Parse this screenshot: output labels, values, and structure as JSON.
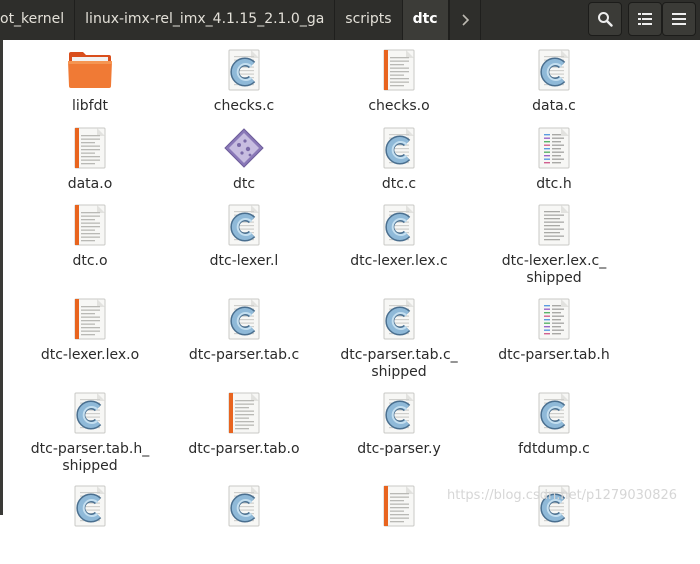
{
  "header": {
    "breadcrumbs": [
      "ot_kernel",
      "linux-imx-rel_imx_4.1.15_2.1.0_ga",
      "scripts",
      "dtc"
    ],
    "forward_icon": "chevron-right-icon",
    "search_icon": "search-icon",
    "view_icon": "list-view-icon",
    "menu_icon": "menu-icon"
  },
  "files": [
    {
      "name": "libfdt",
      "type": "folder"
    },
    {
      "name": "checks.c",
      "type": "c-source"
    },
    {
      "name": "checks.o",
      "type": "object"
    },
    {
      "name": "data.c",
      "type": "c-source"
    },
    {
      "name": "data.o",
      "type": "object"
    },
    {
      "name": "dtc",
      "type": "executable"
    },
    {
      "name": "dtc.c",
      "type": "c-source"
    },
    {
      "name": "dtc.h",
      "type": "header"
    },
    {
      "name": "dtc.o",
      "type": "object"
    },
    {
      "name": "dtc-lexer.l",
      "type": "c-source"
    },
    {
      "name": "dtc-lexer.lex.c",
      "type": "c-source"
    },
    {
      "name": "dtc-lexer.lex.c_\nshipped",
      "type": "text"
    },
    {
      "name": "dtc-lexer.lex.o",
      "type": "object"
    },
    {
      "name": "dtc-parser.tab.c",
      "type": "c-source"
    },
    {
      "name": "dtc-parser.tab.c_\nshipped",
      "type": "c-source"
    },
    {
      "name": "dtc-parser.tab.h",
      "type": "header"
    },
    {
      "name": "dtc-parser.tab.h_\nshipped",
      "type": "c-source"
    },
    {
      "name": "dtc-parser.tab.o",
      "type": "object"
    },
    {
      "name": "dtc-parser.y",
      "type": "c-source"
    },
    {
      "name": "fdtdump.c",
      "type": "c-source"
    },
    {
      "name": "",
      "type": "c-source"
    },
    {
      "name": "",
      "type": "c-source"
    },
    {
      "name": "",
      "type": "object"
    },
    {
      "name": "",
      "type": "c-source"
    }
  ],
  "watermark": "https://blog.csdn.net/p1279030826"
}
